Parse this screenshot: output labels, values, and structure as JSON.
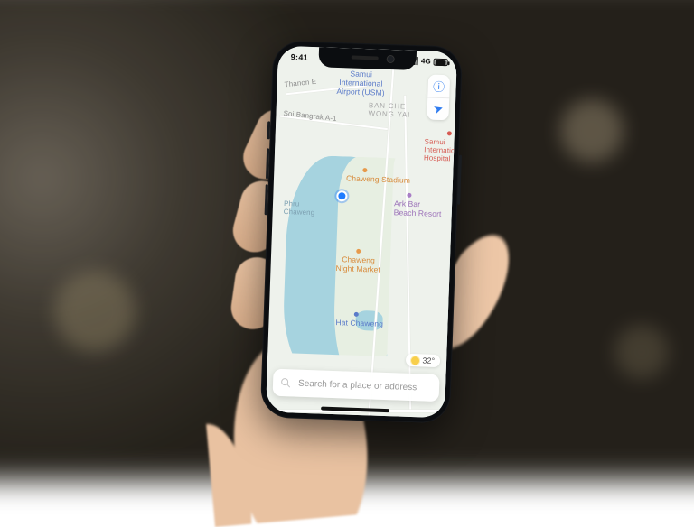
{
  "status_bar": {
    "time": "9:41",
    "network_type": "4G"
  },
  "controls": {
    "info_glyph": "ⓘ",
    "locate_glyph": "➤"
  },
  "weather": {
    "temperature": "32°"
  },
  "search": {
    "placeholder": "Search for a place or address",
    "value": ""
  },
  "map": {
    "area_labels": [
      {
        "id": "ban-che-wong-yai",
        "text": "BAN CHE\nWONG YAI"
      }
    ],
    "roads": [
      {
        "id": "thanon-e",
        "text": "Thanon E"
      },
      {
        "id": "soi-bangrak-a1",
        "text": "Soi Bangrak A-1"
      }
    ],
    "features": [
      {
        "id": "phru-chaweng",
        "text": "Phru\nChaweng"
      }
    ],
    "pois": [
      {
        "id": "samui-airport",
        "text": "Samui\nInternational\nAirport (USM)",
        "kind": "blue"
      },
      {
        "id": "samui-hospital",
        "text": "Samui\nInternationa\nHospital",
        "kind": "red"
      },
      {
        "id": "chaweng-stadium",
        "text": "Chaweng Stadium",
        "kind": "orange"
      },
      {
        "id": "ark-bar",
        "text": "Ark Bar\nBeach Resort",
        "kind": "purple"
      },
      {
        "id": "chaweng-night-market",
        "text": "Chaweng\nNight Market",
        "kind": "orange"
      },
      {
        "id": "hat-chaweng",
        "text": "Hat Chaweng",
        "kind": "blue"
      }
    ]
  }
}
